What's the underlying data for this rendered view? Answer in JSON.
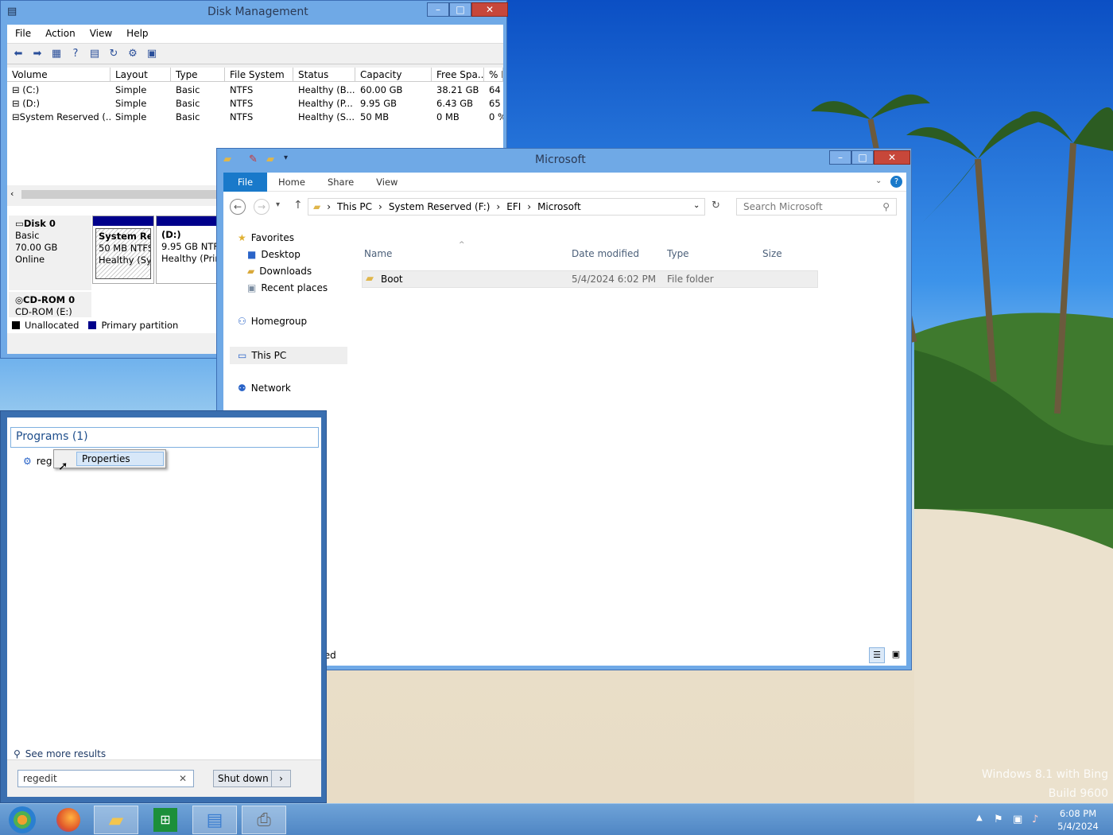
{
  "disk_mgmt": {
    "title": "Disk Management",
    "menu": [
      "File",
      "Action",
      "View",
      "Help"
    ],
    "columns": [
      "Volume",
      "Layout",
      "Type",
      "File System",
      "Status",
      "Capacity",
      "Free Spa...",
      "% F"
    ],
    "rows": [
      [
        "(C:)",
        "Simple",
        "Basic",
        "NTFS",
        "Healthy (B...",
        "60.00 GB",
        "38.21 GB",
        "64"
      ],
      [
        "(D:)",
        "Simple",
        "Basic",
        "NTFS",
        "Healthy (P...",
        "9.95 GB",
        "6.43 GB",
        "65"
      ],
      [
        "System Reserved (...",
        "Simple",
        "Basic",
        "NTFS",
        "Healthy (S...",
        "50 MB",
        "0 MB",
        "0 %"
      ]
    ],
    "disk0": {
      "name": "Disk 0",
      "type": "Basic",
      "size": "70.00 GB",
      "state": "Online"
    },
    "part1": {
      "name": "System Res",
      "detail": "50 MB NTFS",
      "status": "Healthy (Sys"
    },
    "part2": {
      "name": "(D:)",
      "detail": "9.95 GB NTFS",
      "status": "Healthy (Prim"
    },
    "cdrom": {
      "name": "CD-ROM 0",
      "detail": "CD-ROM (E:)"
    },
    "legend": {
      "unallocated": "Unallocated",
      "primary": "Primary partition"
    }
  },
  "explorer": {
    "title": "Microsoft",
    "tabs": {
      "file": "File",
      "home": "Home",
      "share": "Share",
      "view": "View"
    },
    "breadcrumb": [
      "This PC",
      "System Reserved (F:)",
      "EFI",
      "Microsoft"
    ],
    "search_placeholder": "Search Microsoft",
    "nav": {
      "favorites": "Favorites",
      "desktop": "Desktop",
      "downloads": "Downloads",
      "recent": "Recent places",
      "homegroup": "Homegroup",
      "thispc": "This PC",
      "network": "Network"
    },
    "columns": {
      "name": "Name",
      "date": "Date modified",
      "type": "Type",
      "size": "Size"
    },
    "file": {
      "name": "Boot",
      "date": "5/4/2024 6:02 PM",
      "type": "File folder"
    },
    "status_partial": "ted"
  },
  "start": {
    "group": "Programs (1)",
    "item_partial": "reg",
    "context_item": "Properties",
    "see_more": "See more results",
    "search_value": "regedit",
    "shutdown": "Shut down"
  },
  "taskbar": {
    "time": "6:08 PM",
    "date": "5/4/2024"
  },
  "watermark": {
    "line1": "Windows 8.1 with Bing",
    "line2": "Build 9600"
  },
  "colors": {
    "titlebar": "#6fa9e6",
    "primary_partition": "#00008b",
    "file_tab": "#1979ca"
  }
}
